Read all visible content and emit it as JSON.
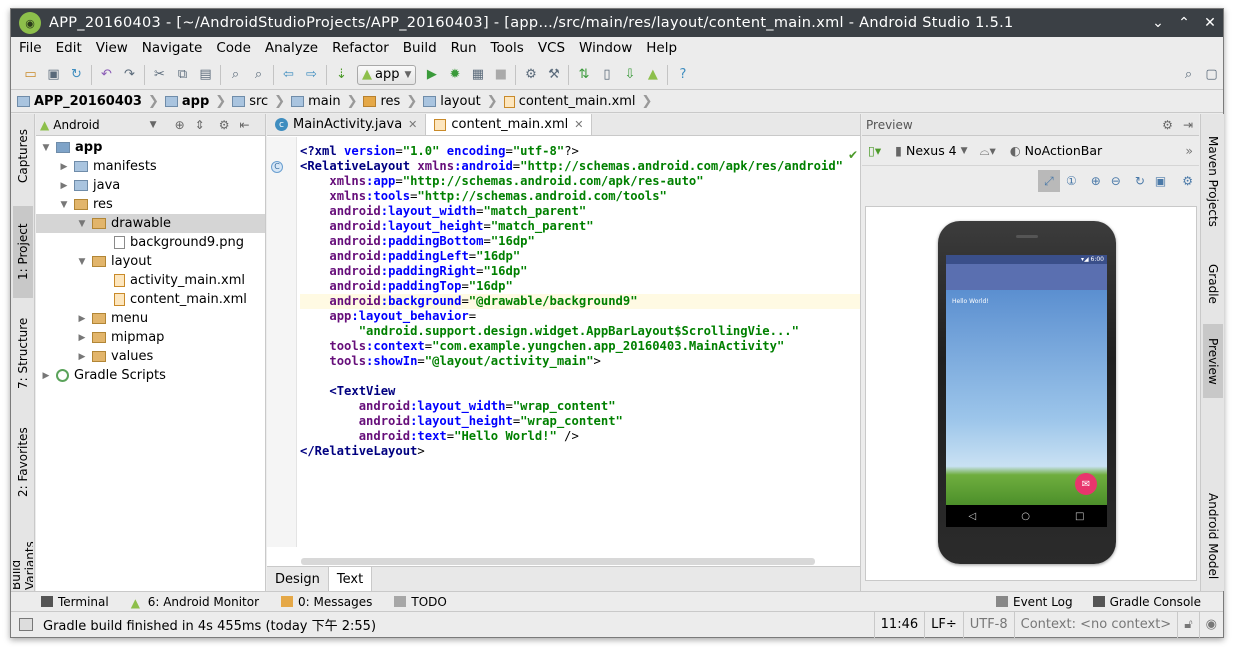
{
  "window": {
    "title": "APP_20160403 - [~/AndroidStudioProjects/APP_20160403] - [app…/src/main/res/layout/content_main.xml - Android Studio 1.5.1"
  },
  "menu": [
    "File",
    "Edit",
    "View",
    "Navigate",
    "Code",
    "Analyze",
    "Refactor",
    "Build",
    "Run",
    "Tools",
    "VCS",
    "Window",
    "Help"
  ],
  "toolbar": {
    "run_config": "app"
  },
  "breadcrumbs": [
    "APP_20160403",
    "app",
    "src",
    "main",
    "res",
    "layout",
    "content_main.xml"
  ],
  "left_tabs": [
    "Captures",
    "1: Project",
    "7: Structure",
    "2: Favorites",
    "Build Variants"
  ],
  "project": {
    "view": "Android",
    "tree": [
      {
        "label": "app",
        "level": 0,
        "type": "module",
        "expanded": true
      },
      {
        "label": "manifests",
        "level": 1,
        "type": "folder"
      },
      {
        "label": "java",
        "level": 1,
        "type": "folder"
      },
      {
        "label": "res",
        "level": 1,
        "type": "res",
        "expanded": true
      },
      {
        "label": "drawable",
        "level": 2,
        "type": "res",
        "expanded": true,
        "selected": true
      },
      {
        "label": "background9.png",
        "level": 3,
        "type": "file"
      },
      {
        "label": "layout",
        "level": 2,
        "type": "res",
        "expanded": true
      },
      {
        "label": "activity_main.xml",
        "level": 3,
        "type": "xml"
      },
      {
        "label": "content_main.xml",
        "level": 3,
        "type": "xml"
      },
      {
        "label": "menu",
        "level": 2,
        "type": "res"
      },
      {
        "label": "mipmap",
        "level": 2,
        "type": "res"
      },
      {
        "label": "values",
        "level": 2,
        "type": "res"
      },
      {
        "label": "Gradle Scripts",
        "level": 0,
        "type": "gradle"
      }
    ]
  },
  "editor": {
    "tabs": [
      {
        "label": "MainActivity.java",
        "active": false
      },
      {
        "label": "content_main.xml",
        "active": true
      }
    ],
    "code": [
      "<?xml version=\"1.0\" encoding=\"utf-8\"?>",
      "<RelativeLayout xmlns:android=\"http://schemas.android.com/apk/res/android\"",
      "    xmlns:app=\"http://schemas.android.com/apk/res-auto\"",
      "    xmlns:tools=\"http://schemas.android.com/tools\"",
      "    android:layout_width=\"match_parent\"",
      "    android:layout_height=\"match_parent\"",
      "    android:paddingBottom=\"16dp\"",
      "    android:paddingLeft=\"16dp\"",
      "    android:paddingRight=\"16dp\"",
      "    android:paddingTop=\"16dp\"",
      "    android:background=\"@drawable/background9\"",
      "    app:layout_behavior=",
      "        \"android.support.design.widget.AppBarLayout$ScrollingVie...\"",
      "    tools:context=\"com.example.yungchen.app_20160403.MainActivity\"",
      "    tools:showIn=\"@layout/activity_main\">",
      "",
      "    <TextView",
      "        android:layout_width=\"wrap_content\"",
      "        android:layout_height=\"wrap_content\"",
      "        android:text=\"Hello World!\" />",
      "</RelativeLayout>"
    ],
    "bottom_tabs": [
      "Design",
      "Text"
    ],
    "active_bottom_tab": "Text"
  },
  "preview": {
    "title": "Preview",
    "device": "Nexus 4",
    "theme": "NoActionBar",
    "status_time": "6:00",
    "hello": "Hello World!"
  },
  "right_tabs": [
    "Maven Projects",
    "Gradle",
    "Preview",
    "Android Model"
  ],
  "tool_windows": [
    {
      "label": "Terminal"
    },
    {
      "label": "6: Android Monitor"
    },
    {
      "label": "0: Messages"
    },
    {
      "label": "TODO"
    },
    {
      "label": "Event Log"
    },
    {
      "label": "Gradle Console"
    }
  ],
  "status": {
    "message": "Gradle build finished in 4s 455ms (today 下午 2:55)",
    "position": "11:46",
    "line_sep": "LF÷",
    "encoding": "UTF-8",
    "context": "Context: <no context>"
  }
}
